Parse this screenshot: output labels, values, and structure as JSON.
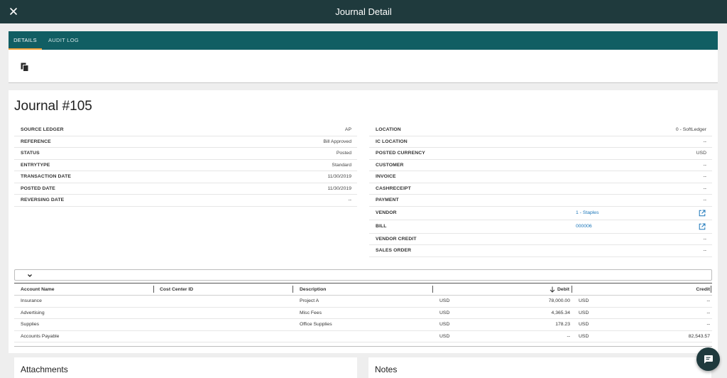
{
  "header": {
    "title": "Journal Detail"
  },
  "tabs": [
    {
      "label": "DETAILS",
      "active": true
    },
    {
      "label": "AUDIT LOG",
      "active": false
    }
  ],
  "journal": {
    "title": "Journal #105"
  },
  "left_props": [
    {
      "label": "SOURCE LEDGER",
      "value": "AP"
    },
    {
      "label": "REFERENCE",
      "value": "Bill Approved"
    },
    {
      "label": "STATUS",
      "value": "Posted"
    },
    {
      "label": "ENTRYTYPE",
      "value": "Standard"
    },
    {
      "label": "TRANSACTION DATE",
      "value": "11/30/2019"
    },
    {
      "label": "POSTED DATE",
      "value": "11/30/2019"
    },
    {
      "label": "REVERSING DATE",
      "value": "--"
    }
  ],
  "right_props": [
    {
      "label": "LOCATION",
      "value": "0 - SoftLedger"
    },
    {
      "label": "IC LOCATION",
      "value": "--"
    },
    {
      "label": "POSTED CURRENCY",
      "value": "USD"
    },
    {
      "label": "CUSTOMER",
      "value": "--"
    },
    {
      "label": "INVOICE",
      "value": "--"
    },
    {
      "label": "CASHRECEIPT",
      "value": "--"
    },
    {
      "label": "PAYMENT",
      "value": "--"
    },
    {
      "label": "VENDOR",
      "value": "1 - Staples",
      "link": true
    },
    {
      "label": "BILL",
      "value": "000006",
      "link": true
    },
    {
      "label": "VENDOR CREDIT",
      "value": "--"
    },
    {
      "label": "SALES ORDER",
      "value": "--"
    }
  ],
  "grid": {
    "columns": {
      "account": "Account Name",
      "cost_center": "Cost Center ID",
      "description": "Description",
      "debit": "Debit",
      "credit": "Credit"
    },
    "rows": [
      {
        "account": "Insurance",
        "cost_center": "",
        "description": "Project A",
        "debit_currency": "USD",
        "debit": "78,000.00",
        "credit_currency": "USD",
        "credit": "--"
      },
      {
        "account": "Advertising",
        "cost_center": "",
        "description": "Misc Fees",
        "debit_currency": "USD",
        "debit": "4,365.34",
        "credit_currency": "USD",
        "credit": "--"
      },
      {
        "account": "Supplies",
        "cost_center": "",
        "description": "Office Supplies",
        "debit_currency": "USD",
        "debit": "178.23",
        "credit_currency": "USD",
        "credit": "--"
      },
      {
        "account": "Accounts Payable",
        "cost_center": "",
        "description": "",
        "debit_currency": "USD",
        "debit": "--",
        "credit_currency": "USD",
        "credit": "82,543.57"
      }
    ]
  },
  "sections": {
    "attachments": "Attachments",
    "notes": "Notes"
  },
  "colors": {
    "header_bg": "#1f3a3d",
    "tab_bar_bg": "#115e63",
    "tab_indicator": "#f2a33a",
    "link": "#1b76b9"
  },
  "icons": {
    "close": "close-icon",
    "copy": "copy-icon",
    "external": "open-in-new-icon",
    "chevron": "chevron-down-icon",
    "sort": "arrow-down-icon",
    "chat": "chat-icon"
  }
}
